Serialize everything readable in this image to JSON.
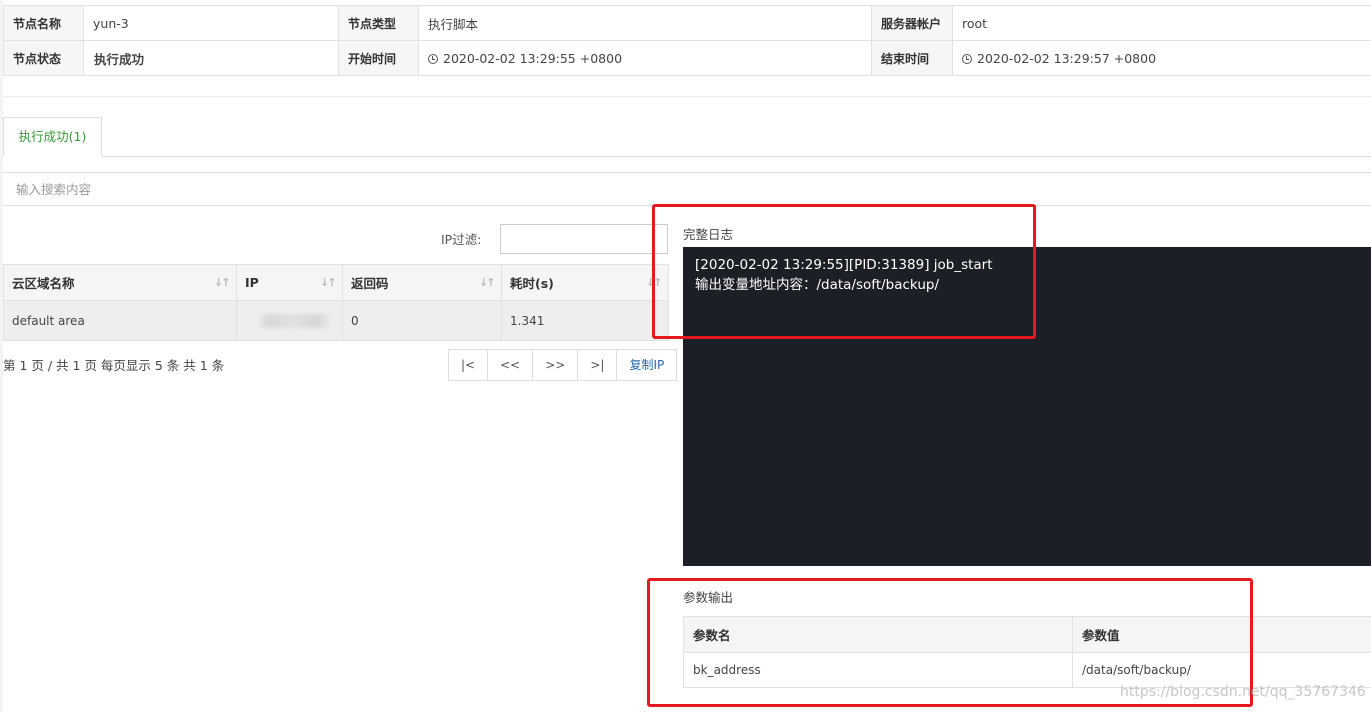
{
  "info": {
    "node_name_label": "节点名称",
    "node_name": "yun-3",
    "node_type_label": "节点类型",
    "node_type": "执行脚本",
    "account_label": "服务器帐户",
    "account": "root",
    "status_label": "节点状态",
    "status": "执行成功",
    "start_label": "开始时间",
    "start_time": "2020-02-02 13:29:55 +0800",
    "end_label": "结束时间",
    "end_time": "2020-02-02 13:29:57 +0800"
  },
  "tab": {
    "label": "执行成功(1)"
  },
  "search": {
    "placeholder": "输入搜索内容"
  },
  "filter": {
    "label": "IP过滤:"
  },
  "ip_table": {
    "headers": [
      "云区域名称",
      "IP",
      "返回码",
      "耗时(s)"
    ],
    "rows": [
      {
        "area": "default area",
        "ip": "",
        "code": "0",
        "time": "1.341"
      }
    ]
  },
  "pagination": {
    "info": "第 1 页 / 共 1 页  每页显示 5 条  共 1 条",
    "first": "|<",
    "prev": "<<",
    "next": ">>",
    "last": ">|",
    "copy_ip": "复制IP"
  },
  "log": {
    "title": "完整日志",
    "line1": "[2020-02-02 13:29:55][PID:31389] job_start",
    "line2": "输出变量地址内容：/data/soft/backup/"
  },
  "params": {
    "title": "参数输出",
    "headers": [
      "参数名",
      "参数值"
    ],
    "rows": [
      {
        "name": "bk_address",
        "value": "/data/soft/backup/"
      }
    ]
  },
  "watermark": "https://blog.csdn.net/qq_35767346",
  "colors": {
    "success": "#3cb55a",
    "annotation": "#e5191f",
    "log_bg": "#1c1f26",
    "link": "#2a6ab2"
  }
}
